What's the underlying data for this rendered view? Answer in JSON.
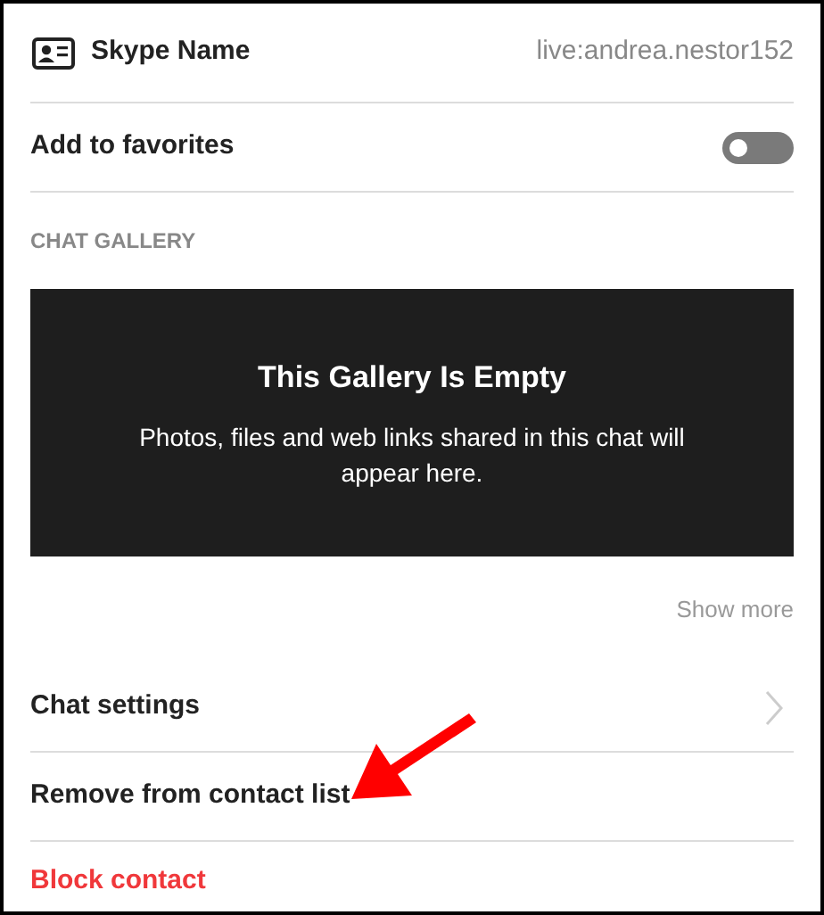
{
  "profile": {
    "label": "Skype Name",
    "value": "live:andrea.nestor152"
  },
  "favorites": {
    "label": "Add to favorites",
    "on": false
  },
  "gallery": {
    "heading": "CHAT GALLERY",
    "title": "This Gallery Is Empty",
    "message": "Photos, files and web links shared in this chat will appear here.",
    "show_more": "Show more"
  },
  "actions": [
    {
      "label": "Chat settings",
      "kind": "link"
    },
    {
      "label": "Remove from contact list",
      "kind": "plain"
    },
    {
      "label": "Block contact",
      "kind": "danger"
    }
  ]
}
